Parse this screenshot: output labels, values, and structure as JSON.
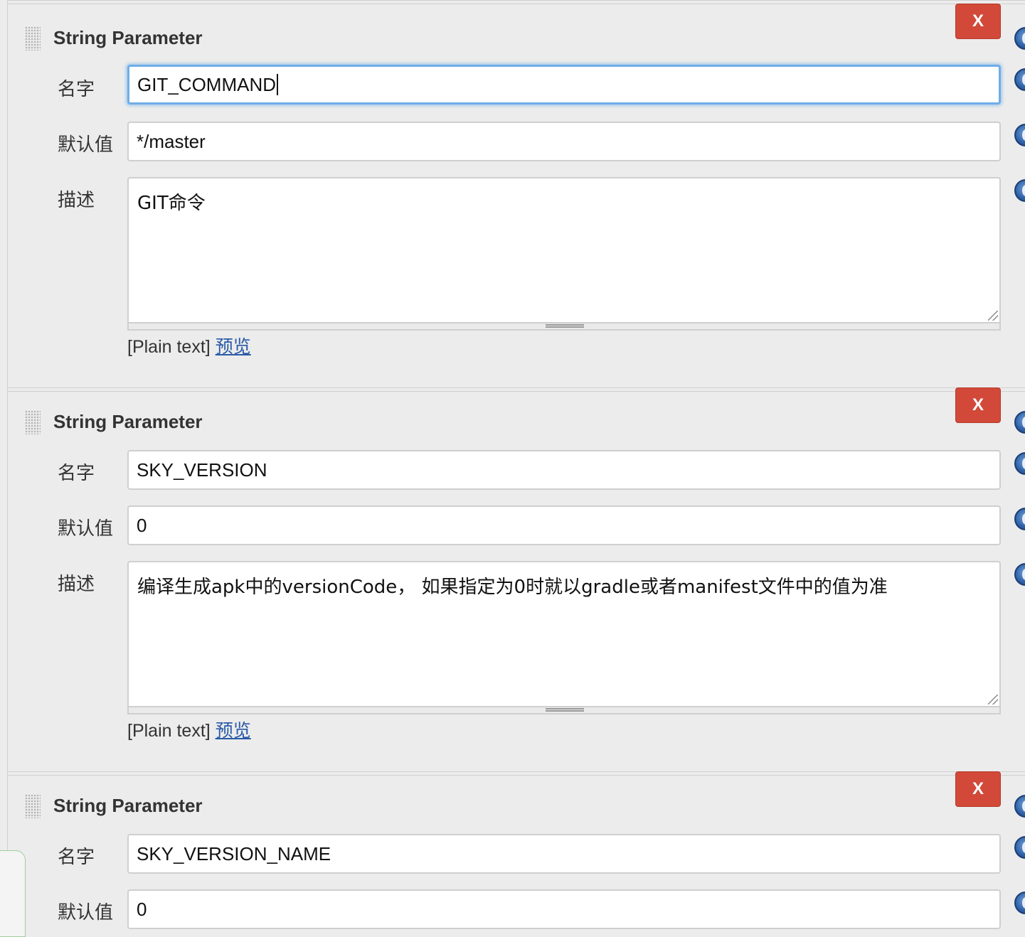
{
  "parameters": [
    {
      "type_label": "String Parameter",
      "delete_label": "X",
      "name_label": "名字",
      "name_value": "GIT_COMMAND",
      "default_label": "默认值",
      "default_value": "*/master",
      "desc_label": "描述",
      "desc_value": "GIT命令",
      "format_hint": "[Plain text]",
      "preview_link": "预览"
    },
    {
      "type_label": "String Parameter",
      "delete_label": "X",
      "name_label": "名字",
      "name_value": "SKY_VERSION",
      "default_label": "默认值",
      "default_value": "0",
      "desc_label": "描述",
      "desc_value": "编译生成apk中的versionCode， 如果指定为0时就以gradle或者manifest文件中的值为准",
      "format_hint": "[Plain text]",
      "preview_link": "预览"
    },
    {
      "type_label": "String Parameter",
      "delete_label": "X",
      "name_label": "名字",
      "name_value": "SKY_VERSION_NAME",
      "default_label": "默认值",
      "default_value": "0"
    }
  ],
  "colors": {
    "delete_button": "#d24939",
    "focus_ring": "#6faee8",
    "link": "#2a5aa8",
    "help_icon": "#2d5fa6"
  }
}
